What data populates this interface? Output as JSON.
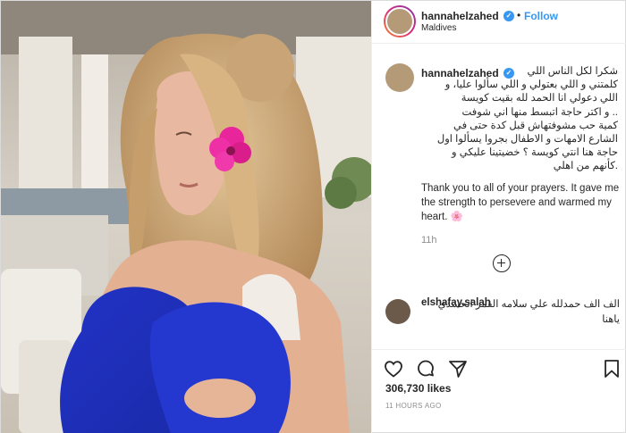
{
  "post": {
    "author": {
      "username": "hannahelzahed",
      "verified": true,
      "follow_label": "Follow",
      "separator": "•",
      "location": "Maldives"
    },
    "caption": {
      "arabic": "شكرا لكل الناس اللي\nكلمتني و اللي بعتولي و اللي سألوا عليا، و\nاللي دعولي انا الحمد لله بقيت كويسة\n.. و اكتر حاجة اتبسط منها اني شوفت\nكمية حب مشوفتهاش قبل كدة حتى في\nالشارع الامهات و الاطفال بجروا يسألوا اول\nحاجة هنا انتي كويسة ؟ خضيتينا عليكي و\n.كأنهم من اهلي",
      "english": "Thank you to all of your prayers. It gave me the strength to persevere and warmed my heart. 🌸",
      "time_ago": "11h"
    },
    "comments": [
      {
        "username": "elshafay.salah",
        "text": "الف الف حمدلله علي سلامه القمر اتحسدي ياهنا"
      }
    ],
    "more_comments_hint": "View more",
    "icons": {
      "like": "heart-icon",
      "comment": "comment-bubble-icon",
      "share": "share-arrow-icon",
      "save": "bookmark-icon",
      "load_more": "plus-circle-icon",
      "verified": "verified-badge-icon"
    },
    "likes": "306,730 likes",
    "posted_ago": "11 HOURS AGO",
    "colors": {
      "accent": "#3897f0",
      "text": "#262626",
      "muted": "#8e8e8e",
      "border": "#efefef",
      "story_ring_start": "#f58529",
      "story_ring_end": "#8134af"
    }
  }
}
